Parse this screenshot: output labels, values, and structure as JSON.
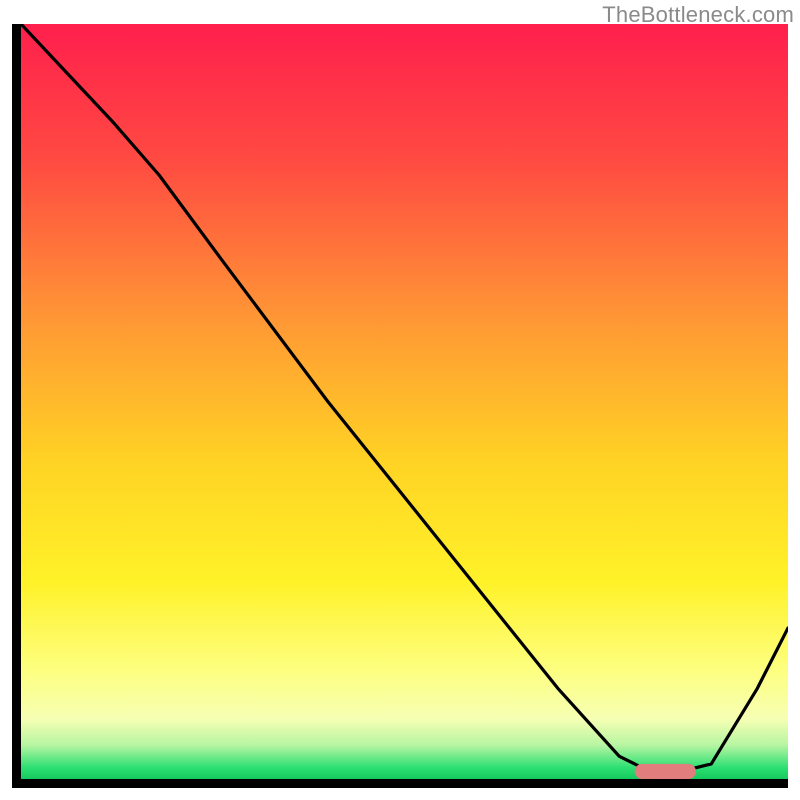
{
  "watermark": "TheBottleneck.com",
  "chart_data": {
    "type": "line",
    "title": "",
    "xlabel": "",
    "ylabel": "",
    "xlim": [
      0,
      100
    ],
    "ylim": [
      0,
      100
    ],
    "grid": false,
    "legend": false,
    "series": [
      {
        "name": "curve",
        "x": [
          0,
          12,
          18,
          26,
          40,
          55,
          70,
          78,
          82,
          86,
          90,
          96,
          100
        ],
        "y": [
          100,
          87,
          80,
          69,
          50,
          31,
          12,
          3,
          1,
          1,
          2,
          12,
          20
        ]
      }
    ],
    "marker": {
      "name": "optimal-pill",
      "x_range": [
        80,
        88
      ],
      "y": 1,
      "color": "#e27d7d"
    },
    "background_gradient": {
      "stops": [
        {
          "offset": 0.0,
          "color": "#ff1f4d"
        },
        {
          "offset": 0.18,
          "color": "#ff4a42"
        },
        {
          "offset": 0.4,
          "color": "#ff9a34"
        },
        {
          "offset": 0.58,
          "color": "#ffd324"
        },
        {
          "offset": 0.74,
          "color": "#fff229"
        },
        {
          "offset": 0.86,
          "color": "#fdff83"
        },
        {
          "offset": 0.92,
          "color": "#f6ffb3"
        },
        {
          "offset": 0.955,
          "color": "#b7f5a2"
        },
        {
          "offset": 0.985,
          "color": "#2ddf73"
        },
        {
          "offset": 1.0,
          "color": "#14c95e"
        }
      ]
    }
  }
}
